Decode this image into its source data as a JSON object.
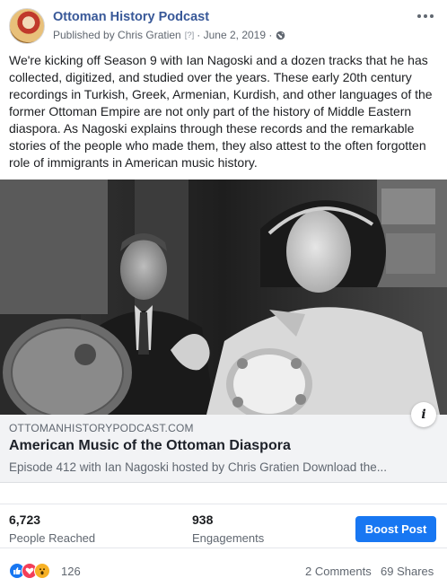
{
  "header": {
    "page_name": "Ottoman History Podcast",
    "published_by": "Published by Chris Gratien",
    "help_mark": "[?]",
    "date": "· June 2, 2019 ·"
  },
  "post": {
    "text": "We're kicking off Season 9 with Ian Nagoski and a dozen tracks that he has collected, digitized, and studied over the years. These early 20th century recordings in Turkish, Greek, Armenian, Kurdish, and other languages of the former Ottoman Empire are not only part of the history of Middle Eastern diaspora. As Nagoski explains through these records and the remarkable stories of the people who made them, they also attest to the often forgotten role of immigrants in American music history."
  },
  "link_preview": {
    "domain": "OTTOMANHISTORYPODCAST.COM",
    "title": "American Music of the Ottoman Diaspora",
    "description": "Episode 412 with Ian Nagoski hosted by Chris Gratien Download the..."
  },
  "insights": {
    "reached_value": "6,723",
    "reached_label": "People Reached",
    "engagements_value": "938",
    "engagements_label": "Engagements",
    "boost_label": "Boost Post"
  },
  "reactions": {
    "icons": [
      "like-icon",
      "love-icon",
      "wow-icon"
    ],
    "count": "126",
    "comments": "2 Comments",
    "shares": "69 Shares"
  },
  "colors": {
    "link_blue": "#385898",
    "boost_blue": "#1877f2",
    "like_blue": "#1877f2",
    "love_red": "#f33e58",
    "wow_yellow": "#f7b125"
  }
}
